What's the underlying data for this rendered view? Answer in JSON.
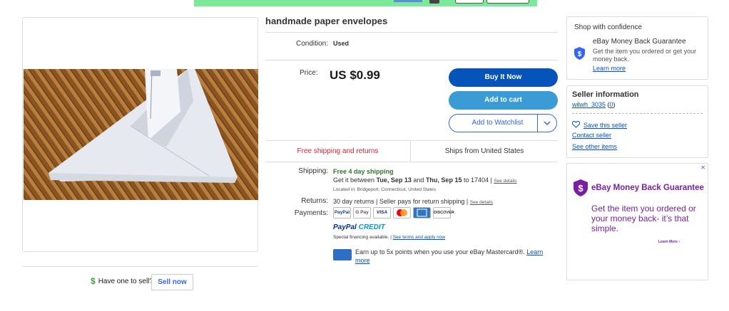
{
  "item": {
    "title": "handmade paper envelopes",
    "condition_label": "Condition:",
    "condition_value": "Used",
    "price_label": "Price:",
    "price_value": "US $0.99"
  },
  "actions": {
    "buy_now": "Buy It Now",
    "add_to_cart": "Add to cart",
    "add_to_watchlist": "Add to Watchlist"
  },
  "shipping_bar": {
    "free_shipping": "Free shipping and returns",
    "ships_from": "Ships from United States"
  },
  "details": {
    "shipping_label": "Shipping:",
    "shipping_headline": "Free 4 day shipping",
    "delivery_prefix": "Get it between ",
    "delivery_start": "Tue, Sep 13",
    "delivery_and": " and ",
    "delivery_end": "Thu, Sep 15",
    "delivery_to": " to 17404 | ",
    "see_details": "See details",
    "located_in": "Located in: Bridgeport, Connecticut, United States",
    "returns_label": "Returns:",
    "returns_text": "30 day returns | Seller pays for return shipping | ",
    "returns_see_details": "See details",
    "payments_label": "Payments:",
    "payment_logos": [
      "PayPal",
      "G Pay",
      "VISA",
      "mastercard",
      "AMEX",
      "DISCOVER"
    ],
    "paypal_credit_1": "PayPal",
    "paypal_credit_2": "CREDIT",
    "financing_text": "Special financing available. | ",
    "financing_link": "See terms and apply now",
    "mastercard_promo": "Earn up to 5x points when you use your eBay Mastercard®. ",
    "learn_more": "Learn more"
  },
  "sell": {
    "have_one": "Have one to sell?",
    "sell_now": "Sell now"
  },
  "confidence": {
    "heading": "Shop with confidence",
    "guarantee_title": "eBay Money Back Guarantee",
    "guarantee_text": "Get the item you ordered or get your money back.",
    "learn_more": "Learn more"
  },
  "seller": {
    "heading": "Seller information",
    "username": "wilwh_3035",
    "feedback_open": " (",
    "feedback": "0",
    "feedback_close": ")",
    "save_seller": "Save this seller",
    "contact": "Contact seller",
    "other_items": "See other items"
  },
  "ad": {
    "title": "eBay Money Back Guarantee",
    "body": "Get the item you ordered or your money back- it’s that simple.",
    "learn_more": "Learn More ›",
    "close": "✕"
  },
  "colors": {
    "buy_now": "#0654ba",
    "add_to_cart": "#3a9bd5",
    "free_shipping": "#dd1e31",
    "ad_purple": "#7a1fa2"
  }
}
